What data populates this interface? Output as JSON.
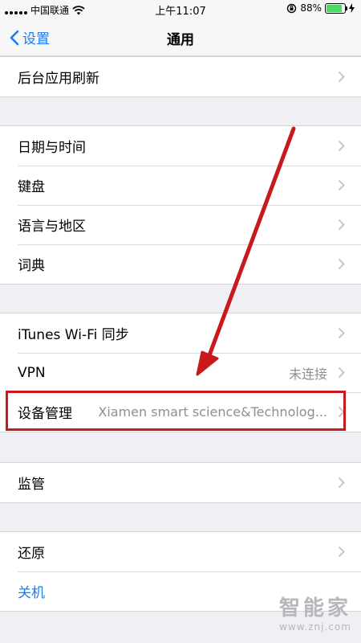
{
  "status_bar": {
    "carrier": "中国联通",
    "time": "上午11:07",
    "battery_percent": "88%",
    "battery_level": 0.88
  },
  "nav": {
    "back_label": "设置",
    "title": "通用"
  },
  "groups": [
    {
      "items": [
        {
          "label": "后台应用刷新"
        }
      ]
    },
    {
      "items": [
        {
          "label": "日期与时间"
        },
        {
          "label": "键盘"
        },
        {
          "label": "语言与地区"
        },
        {
          "label": "词典"
        }
      ]
    },
    {
      "items": [
        {
          "label": "iTunes Wi-Fi 同步"
        },
        {
          "label": "VPN",
          "detail": "未连接"
        },
        {
          "label": "设备管理",
          "detail": "Xiamen smart science&Technolog..."
        }
      ]
    },
    {
      "items": [
        {
          "label": "监管"
        }
      ]
    },
    {
      "items": [
        {
          "label": "还原"
        },
        {
          "label": "关机"
        }
      ]
    }
  ],
  "annotation_color": "#c8191c",
  "accent_color": "#1a7cf0",
  "watermark": {
    "main": "智能家",
    "url": "www.znj.com"
  }
}
